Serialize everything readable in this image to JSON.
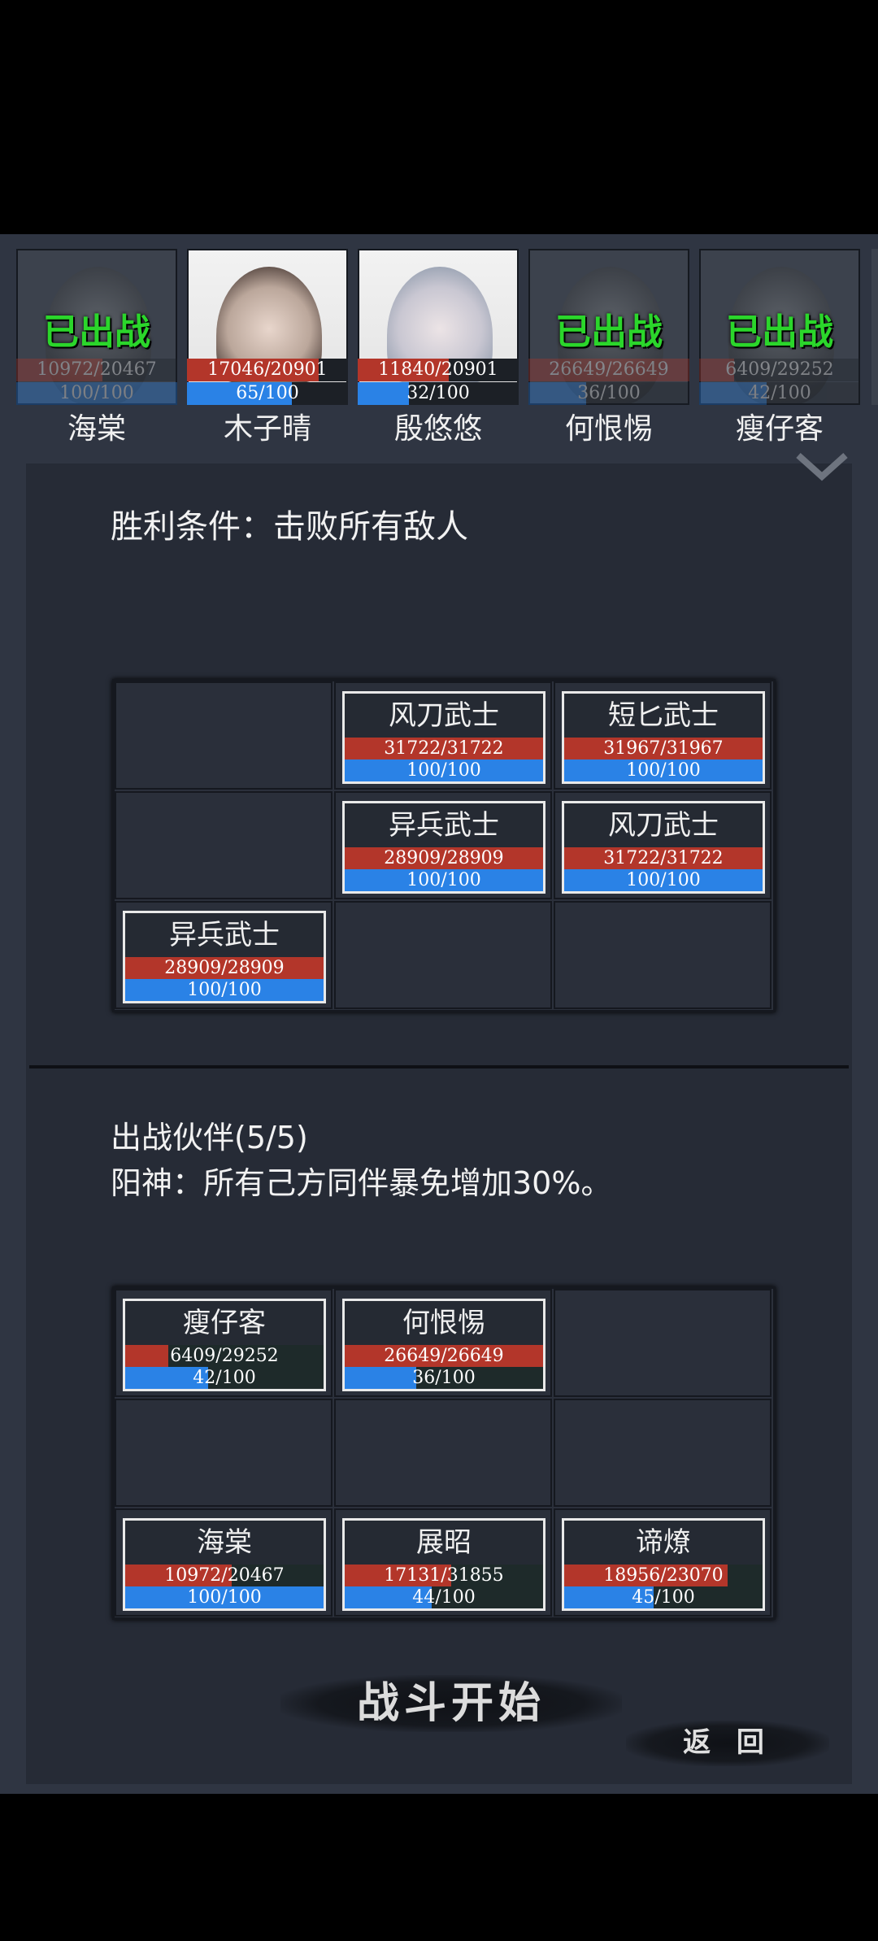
{
  "roster": [
    {
      "name": "海棠",
      "deployed_label": "已出战",
      "hp": "10972/20467",
      "hp_ratio": 0.536,
      "mp": "100/100",
      "mp_ratio": 1.0,
      "deployed": true
    },
    {
      "name": "木子晴",
      "deployed_label": "",
      "hp": "17046/20901",
      "hp_ratio": 0.816,
      "mp": "65/100",
      "mp_ratio": 0.65,
      "deployed": false
    },
    {
      "name": "殷悠悠",
      "deployed_label": "",
      "hp": "11840/20901",
      "hp_ratio": 0.566,
      "mp": "32/100",
      "mp_ratio": 0.32,
      "deployed": false
    },
    {
      "name": "何恨惕",
      "deployed_label": "已出战",
      "hp": "26649/26649",
      "hp_ratio": 1.0,
      "mp": "36/100",
      "mp_ratio": 0.36,
      "deployed": true
    },
    {
      "name": "瘦仔客",
      "deployed_label": "已出战",
      "hp": "6409/29252",
      "hp_ratio": 0.219,
      "mp": "42/100",
      "mp_ratio": 0.42,
      "deployed": true
    }
  ],
  "victory_condition": "胜利条件：击败所有敌人",
  "enemies": [
    {
      "name": "风刀武士",
      "hp": "31722/31722",
      "hp_ratio": 1.0,
      "mp": "100/100",
      "mp_ratio": 1.0
    },
    {
      "name": "短匕武士",
      "hp": "31967/31967",
      "hp_ratio": 1.0,
      "mp": "100/100",
      "mp_ratio": 1.0
    },
    {
      "name": "异兵武士",
      "hp": "28909/28909",
      "hp_ratio": 1.0,
      "mp": "100/100",
      "mp_ratio": 1.0
    },
    {
      "name": "风刀武士",
      "hp": "31722/31722",
      "hp_ratio": 1.0,
      "mp": "100/100",
      "mp_ratio": 1.0
    },
    {
      "name": "异兵武士",
      "hp": "28909/28909",
      "hp_ratio": 1.0,
      "mp": "100/100",
      "mp_ratio": 1.0
    }
  ],
  "team_title": "出战伙伴(5/5)",
  "team_bonus": "阳神：所有己方同伴暴免增加30%。",
  "allies": [
    {
      "name": "瘦仔客",
      "hp": "6409/29252",
      "hp_ratio": 0.219,
      "mp": "42/100",
      "mp_ratio": 0.42
    },
    {
      "name": "何恨惕",
      "hp": "26649/26649",
      "hp_ratio": 1.0,
      "mp": "36/100",
      "mp_ratio": 0.36
    },
    {
      "name": "海棠",
      "hp": "10972/20467",
      "hp_ratio": 0.536,
      "mp": "100/100",
      "mp_ratio": 1.0
    },
    {
      "name": "展昭",
      "hp": "17131/31855",
      "hp_ratio": 0.538,
      "mp": "44/100",
      "mp_ratio": 0.44
    },
    {
      "name": "谛燎",
      "hp": "18956/23070",
      "hp_ratio": 0.822,
      "mp": "45/100",
      "mp_ratio": 0.45
    }
  ],
  "buttons": {
    "start": "战斗开始",
    "back": "返 回"
  },
  "icons": {
    "collapse": "chevron-down-icon"
  }
}
